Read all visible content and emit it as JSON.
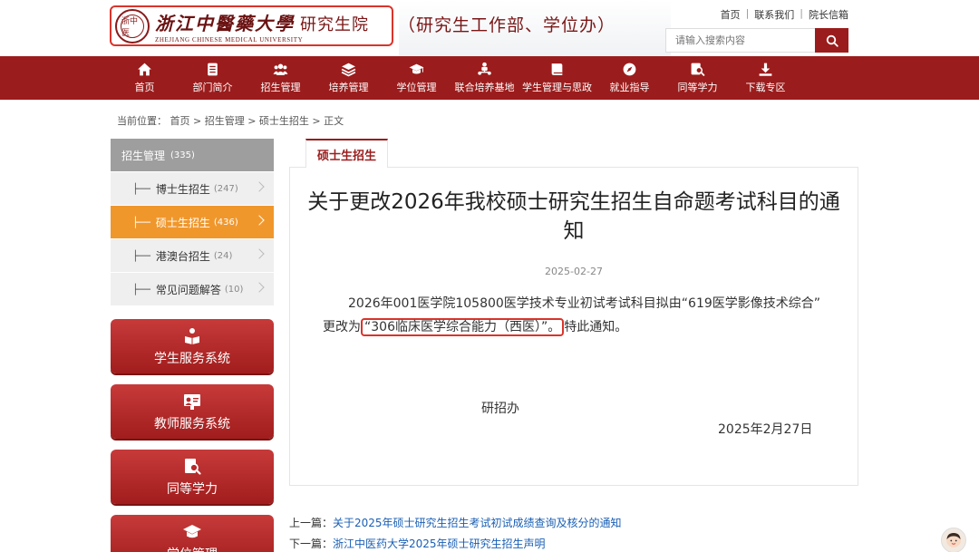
{
  "header": {
    "logo_seal": "浙中医",
    "school_name": "浙江中醫藥大學",
    "school_en": "ZHEJIANG CHINESE MEDICAL UNIVERSITY",
    "grad_school": "研究生院",
    "subtitle": "（研究生工作部、学位办）",
    "toplinks": [
      "首页",
      "联系我们",
      "院长信箱"
    ],
    "search_placeholder": "请输入搜索内容"
  },
  "nav": [
    {
      "label": "首页",
      "icon": "home-icon"
    },
    {
      "label": "部门简介",
      "icon": "document-icon"
    },
    {
      "label": "招生管理",
      "icon": "users-icon"
    },
    {
      "label": "培养管理",
      "icon": "layers-icon"
    },
    {
      "label": "学位管理",
      "icon": "graduation-cap-icon"
    },
    {
      "label": "联合培养基地",
      "icon": "network-icon"
    },
    {
      "label": "学生管理与思政",
      "icon": "book-icon"
    },
    {
      "label": "就业指导",
      "icon": "compass-icon"
    },
    {
      "label": "同等学力",
      "icon": "search-doc-icon"
    },
    {
      "label": "下载专区",
      "icon": "download-icon"
    }
  ],
  "breadcrumb": "当前位置： 首页 > 招生管理 > 硕士生招生 > 正文",
  "sidebar": {
    "header": {
      "label": "招生管理",
      "count": "(335)"
    },
    "items": [
      {
        "label": "博士生招生",
        "count": "(247)",
        "active": false
      },
      {
        "label": "硕士生招生",
        "count": "(436)",
        "active": true
      },
      {
        "label": "港澳台招生",
        "count": "(24)",
        "active": false
      },
      {
        "label": "常见问题解答",
        "count": "(10)",
        "active": false
      }
    ],
    "systems": [
      {
        "label": "学生服务系统",
        "icon": "student-reading-icon"
      },
      {
        "label": "教师服务系统",
        "icon": "teacher-board-icon"
      },
      {
        "label": "同等学力",
        "icon": "search-doc-icon"
      },
      {
        "label": "学位管理",
        "icon": "graduation-cap-icon"
      }
    ]
  },
  "article": {
    "tab": "硕士生招生",
    "title": "关于更改2026年我校硕士研究生招生自命题考试科目的通知",
    "date": "2025-02-27",
    "body_line1": "2026年001医学院105800医学技术专业初试考试科目拟由“619医学影像技术综合”",
    "body_line2_pre": "更改为",
    "body_line2_highlight": "“306临床医学综合能力（西医）”。",
    "body_line2_post": "特此通知。",
    "signature": "研招办",
    "sign_date": "2025年2月27日"
  },
  "prev": {
    "label": "上一篇：",
    "title": "关于2025年硕士研究生招生考试初试成绩查询及核分的通知"
  },
  "next": {
    "label": "下一篇：",
    "title": "浙江中医药大学2025年硕士研究生招生声明"
  },
  "colors": {
    "brand_red": "#9b1c1c",
    "active_orange": "#f0972c",
    "highlight_red": "#d9342b"
  }
}
